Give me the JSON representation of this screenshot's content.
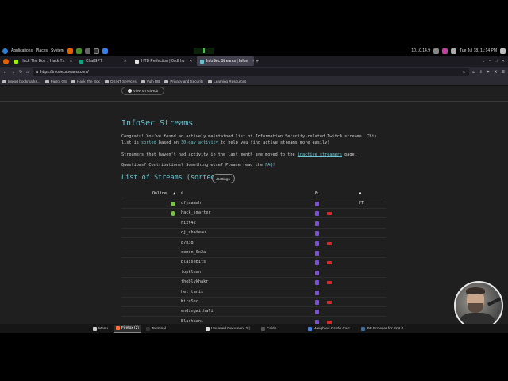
{
  "system_bar": {
    "menus": [
      "Applications",
      "Places",
      "System"
    ],
    "ip": "10.10.14.9",
    "datetime": "Tue Jul 18, 11:14 PM"
  },
  "tabs": [
    {
      "label": "Hack The Box :: Hack Th",
      "color": "#9fef00"
    },
    {
      "label": "ChatGPT",
      "color": "#10a37f"
    },
    {
      "label": "HTB Perfection | 0xdf hu",
      "color": "#e0e0e0"
    },
    {
      "label": "InfoSec Streams | Infos",
      "color": "#6ec3cf",
      "active": true
    }
  ],
  "url": "https://infosecstreams.com/",
  "bookmarks": [
    "Import bookmarks...",
    "Parrot OS",
    "Hack The Box",
    "OSINT Services",
    "Vuln DB",
    "Privacy and Security",
    "Learning Resources"
  ],
  "page": {
    "github_button": "View on GitHub",
    "title": "InfoSec Streams",
    "intro": {
      "p1a": "Congrats! You've found an actively maintained list of Information Security-related Twitch streams. This",
      "p1b_pre": "list is",
      "p1b_sorted": "sorted",
      "p1b_mid": "based on",
      "p1b_activity": "30-day activity",
      "p1b_post": "to help you find active streams more easily!",
      "p2_pre": "Streamers that haven't had activity in the last month are moved to the",
      "p2_link": "inactive streamers",
      "p2_post": "page.",
      "p3_pre": "Questions? Contributions? Something else? Please read the",
      "p3_link": "FAQ",
      "p3_post": "!"
    },
    "list_title": "List of Streams (sorted)",
    "settings_button": "Settings",
    "headers": {
      "online": "Online",
      "sort_arrow": "▲"
    },
    "streamers": [
      {
        "name": "ofjaaaah",
        "online": true,
        "youtube": false,
        "lang": "PT"
      },
      {
        "name": "hack_smarter",
        "online": true,
        "youtube": true,
        "lang": ""
      },
      {
        "name": "Fixt42",
        "online": false,
        "youtube": false,
        "lang": ""
      },
      {
        "name": "dj_chateau",
        "online": false,
        "youtube": false,
        "lang": ""
      },
      {
        "name": "87h38",
        "online": false,
        "youtube": true,
        "lang": ""
      },
      {
        "name": "demon_0x2a",
        "online": false,
        "youtube": false,
        "lang": ""
      },
      {
        "name": "BlaiseBits",
        "online": false,
        "youtube": true,
        "lang": ""
      },
      {
        "name": "topklean",
        "online": false,
        "youtube": false,
        "lang": ""
      },
      {
        "name": "theblvkhakr",
        "online": false,
        "youtube": true,
        "lang": ""
      },
      {
        "name": "het_tanis",
        "online": false,
        "youtube": false,
        "lang": ""
      },
      {
        "name": "KiraSec",
        "online": false,
        "youtube": true,
        "lang": ""
      },
      {
        "name": "endingwithali",
        "online": false,
        "youtube": false,
        "lang": ""
      },
      {
        "name": "Elastaani",
        "online": false,
        "youtube": true,
        "lang": ""
      }
    ]
  },
  "taskbar": [
    {
      "label": "Menu",
      "color": "#cccccc"
    },
    {
      "label": "Firefox (2)",
      "color": "#ff7139",
      "active": true
    },
    {
      "label": "Terminal",
      "color": "#333333"
    },
    {
      "label": "Unsaved Document 2 |...",
      "color": "#e0e0e0"
    },
    {
      "label": "Caido",
      "color": "#555555"
    },
    {
      "label": "Weighted Grade Calc...",
      "color": "#4a7fd6"
    },
    {
      "label": "DB Browser for SQLit...",
      "color": "#3a6ea5"
    }
  ]
}
